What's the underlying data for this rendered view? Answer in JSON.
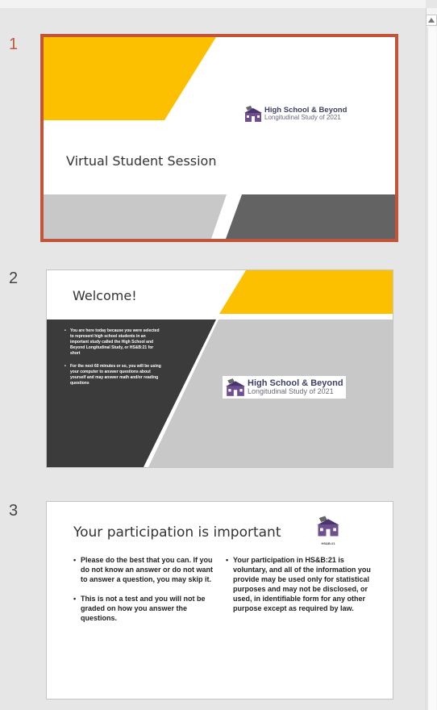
{
  "slides": [
    {
      "number": "1",
      "title": "Virtual Student Session",
      "logo_line1": "High School & Beyond",
      "logo_line2": "Longitudinal Study of 2021"
    },
    {
      "number": "2",
      "title": "Welcome!",
      "bullets": [
        "You are here today because you were selected to represent high school students in an important study called the High School and Beyond Longitudinal Study, or HS&B:21 for short",
        "For the next 60 minutes or so, you will be using your computer to answer questions about yourself and may answer math and/or reading questions"
      ],
      "logo_line1": "High School & Beyond",
      "logo_line2": "Longitudinal Study of 2021"
    },
    {
      "number": "3",
      "title": "Your participation is important",
      "logo_caption": "HS&B:21",
      "left_bullets": [
        "Please do the best that you can. If you do not know an answer or do not want to answer a question, you may skip it.",
        "This is not a test and you will not be graded on how you answer the questions."
      ],
      "right_bullets": [
        "Your participation in HS&B:21 is voluntary, and all of the information you provide may be used only for statistical purposes and may not be disclosed, or used, in identifiable form for any other purpose except as required by law."
      ]
    }
  ],
  "colors": {
    "accent_yellow": "#fcc000",
    "selection_border": "#c0553a",
    "dark_panel": "#3b3b3b",
    "gray_band": "#c8c8c8",
    "dark_gray_band": "#636363"
  }
}
